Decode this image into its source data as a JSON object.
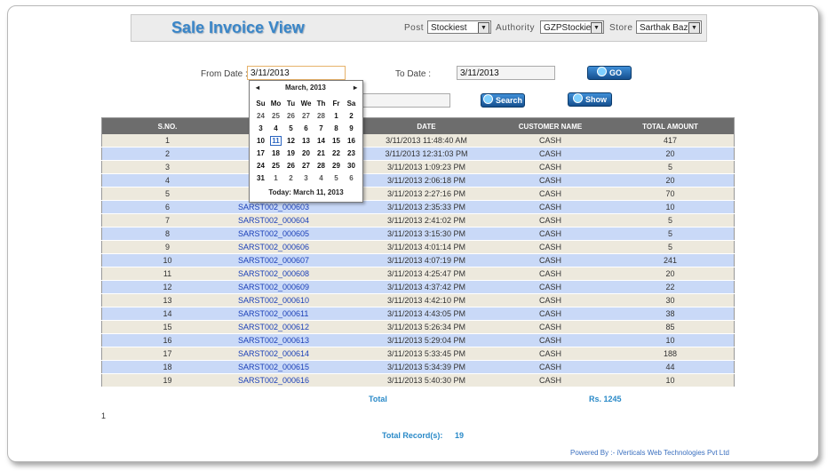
{
  "header": {
    "title": "Sale Invoice View",
    "post_label": "Post",
    "post_value": "Stockiest",
    "authority_label": "Authority",
    "authority_value": "GZPStockies",
    "store_label": "Store",
    "store_value": "Sarthak Baza"
  },
  "filters": {
    "from_label": "From Date :",
    "from_value": "3/11/2013",
    "to_label": "To Date :",
    "to_value": "3/11/2013",
    "go_label": "GO",
    "search_label": "Search",
    "showall_label": "Show All"
  },
  "calendar": {
    "month": "March, 2013",
    "prev": "◂",
    "next": "▸",
    "weekdays": [
      "Su",
      "Mo",
      "Tu",
      "We",
      "Th",
      "Fr",
      "Sa"
    ],
    "weeks": [
      [
        "24",
        "25",
        "26",
        "27",
        "28",
        "1",
        "2"
      ],
      [
        "3",
        "4",
        "5",
        "6",
        "7",
        "8",
        "9"
      ],
      [
        "10",
        "11",
        "12",
        "13",
        "14",
        "15",
        "16"
      ],
      [
        "17",
        "18",
        "19",
        "20",
        "21",
        "22",
        "23"
      ],
      [
        "24",
        "25",
        "26",
        "27",
        "28",
        "29",
        "30"
      ],
      [
        "31",
        "1",
        "2",
        "3",
        "4",
        "5",
        "6"
      ]
    ],
    "selected_day": "11",
    "today": "Today: March 11, 2013"
  },
  "table": {
    "headers": [
      "S.NO.",
      "",
      "DATE",
      "CUSTOMER NAME",
      "TOTAL AMOUNT"
    ],
    "rows": [
      [
        "1",
        "",
        "3/11/2013 11:48:40 AM",
        "CASH",
        "417"
      ],
      [
        "2",
        "",
        "3/11/2013 12:31:03 PM",
        "CASH",
        "20"
      ],
      [
        "3",
        "",
        "3/11/2013 1:09:23 PM",
        "CASH",
        "5"
      ],
      [
        "4",
        "",
        "3/11/2013 2:06:18 PM",
        "CASH",
        "20"
      ],
      [
        "5",
        "",
        "3/11/2013 2:27:16 PM",
        "CASH",
        "70"
      ],
      [
        "6",
        "SARST002_000603",
        "3/11/2013 2:35:33 PM",
        "CASH",
        "10"
      ],
      [
        "7",
        "SARST002_000604",
        "3/11/2013 2:41:02 PM",
        "CASH",
        "5"
      ],
      [
        "8",
        "SARST002_000605",
        "3/11/2013 3:15:30 PM",
        "CASH",
        "5"
      ],
      [
        "9",
        "SARST002_000606",
        "3/11/2013 4:01:14 PM",
        "CASH",
        "5"
      ],
      [
        "10",
        "SARST002_000607",
        "3/11/2013 4:07:19 PM",
        "CASH",
        "241"
      ],
      [
        "11",
        "SARST002_000608",
        "3/11/2013 4:25:47 PM",
        "CASH",
        "20"
      ],
      [
        "12",
        "SARST002_000609",
        "3/11/2013 4:37:42 PM",
        "CASH",
        "22"
      ],
      [
        "13",
        "SARST002_000610",
        "3/11/2013 4:42:10 PM",
        "CASH",
        "30"
      ],
      [
        "14",
        "SARST002_000611",
        "3/11/2013 4:43:05 PM",
        "CASH",
        "38"
      ],
      [
        "15",
        "SARST002_000612",
        "3/11/2013 5:26:34 PM",
        "CASH",
        "85"
      ],
      [
        "16",
        "SARST002_000613",
        "3/11/2013 5:29:04 PM",
        "CASH",
        "10"
      ],
      [
        "17",
        "SARST002_000614",
        "3/11/2013 5:33:45 PM",
        "CASH",
        "188"
      ],
      [
        "18",
        "SARST002_000615",
        "3/11/2013 5:34:39 PM",
        "CASH",
        "44"
      ],
      [
        "19",
        "SARST002_000616",
        "3/11/2013 5:40:30 PM",
        "CASH",
        "10"
      ]
    ],
    "total_label": "Total",
    "total_value": "Rs. 1245"
  },
  "pager": {
    "page": "1"
  },
  "records": {
    "label": "Total Record(s):",
    "count": "19"
  },
  "footer": {
    "text": "Powered By :- iVerticals Web Technologies Pvt Ltd"
  },
  "colors": {
    "title": "#3a86c8",
    "header_bg": "#6d6d6d",
    "row_odd": "#ede9dd",
    "row_even": "#c9d9f7",
    "link": "#1a3fb8"
  },
  "icons": {
    "go": "globe-icon",
    "search": "search-icon",
    "showall": "list-icon"
  }
}
